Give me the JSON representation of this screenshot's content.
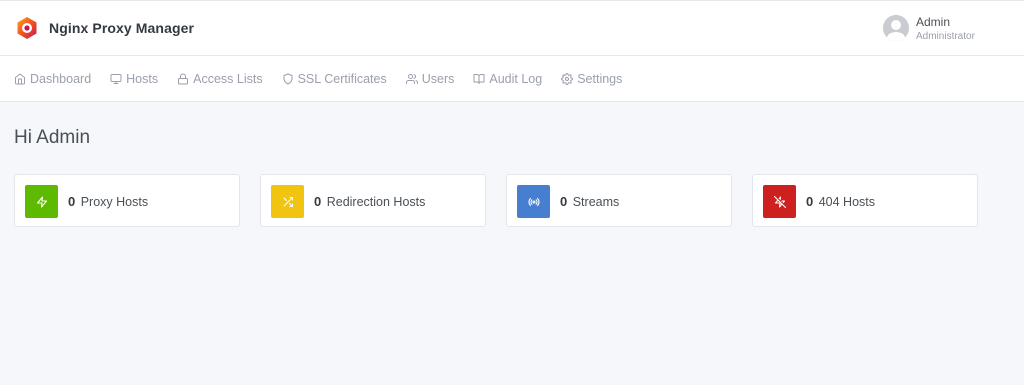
{
  "header": {
    "app_name": "Nginx Proxy Manager",
    "user": {
      "name": "Admin",
      "role": "Administrator"
    }
  },
  "nav": {
    "items": [
      {
        "label": "Dashboard",
        "icon": "home-icon"
      },
      {
        "label": "Hosts",
        "icon": "monitor-icon"
      },
      {
        "label": "Access Lists",
        "icon": "lock-icon"
      },
      {
        "label": "SSL Certificates",
        "icon": "shield-icon"
      },
      {
        "label": "Users",
        "icon": "users-icon"
      },
      {
        "label": "Audit Log",
        "icon": "book-open-icon"
      },
      {
        "label": "Settings",
        "icon": "gear-icon"
      }
    ]
  },
  "main": {
    "greeting": "Hi Admin",
    "cards": [
      {
        "count": "0",
        "label": "Proxy Hosts",
        "icon": "zap-icon",
        "color": "#5eba00"
      },
      {
        "count": "0",
        "label": "Redirection Hosts",
        "icon": "shuffle-icon",
        "color": "#f1c40f"
      },
      {
        "count": "0",
        "label": "Streams",
        "icon": "radio-icon",
        "color": "#467fcf"
      },
      {
        "count": "0",
        "label": "404 Hosts",
        "icon": "zap-off-icon",
        "color": "#cd201f"
      }
    ]
  }
}
